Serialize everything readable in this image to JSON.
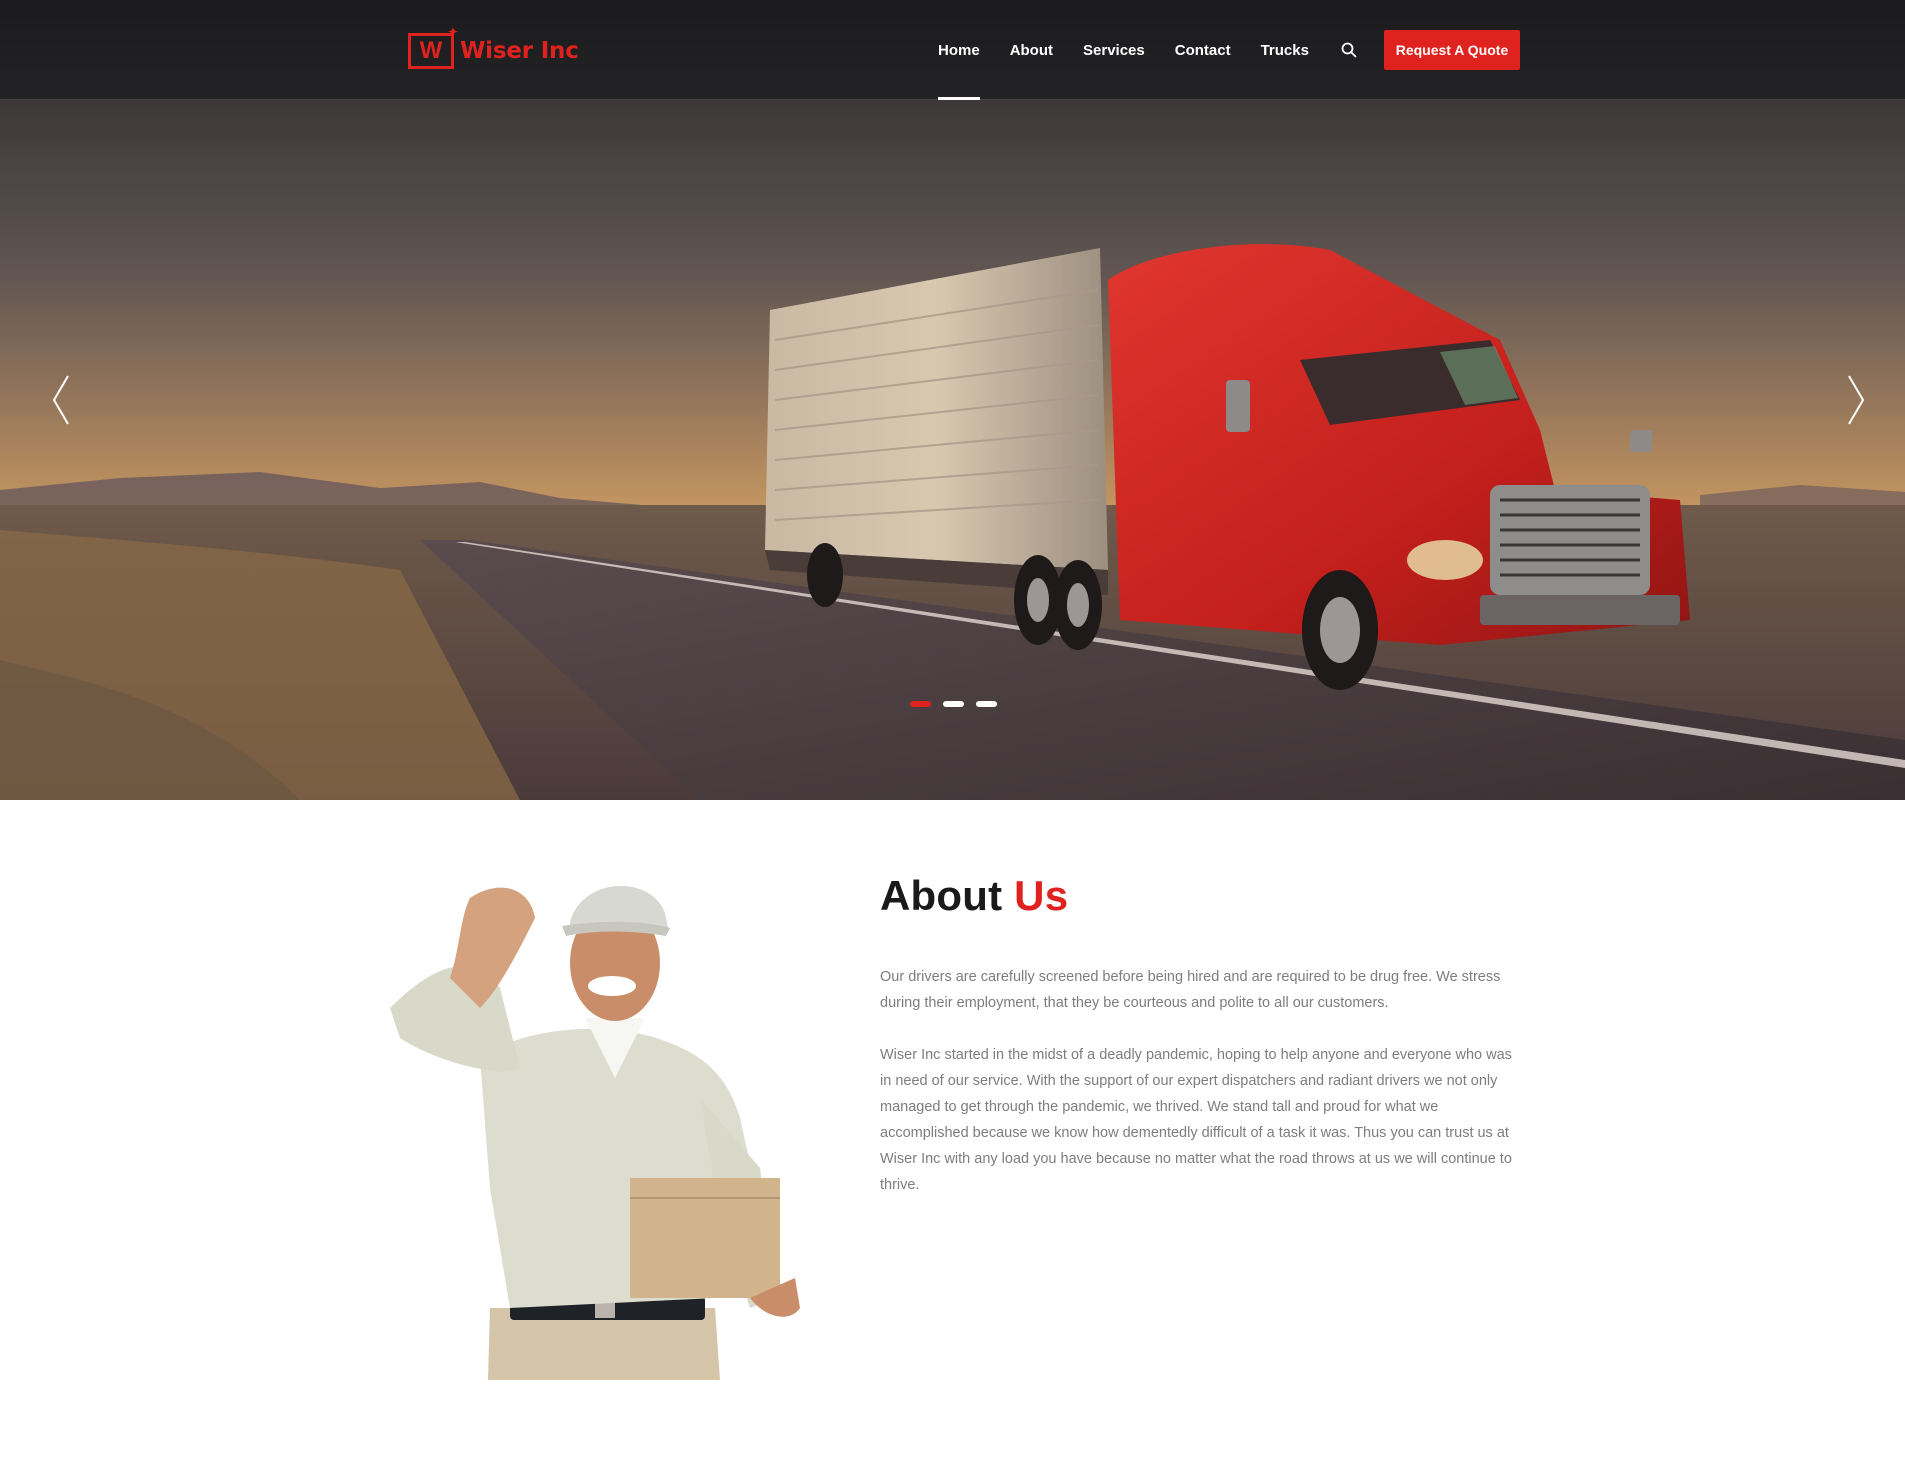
{
  "header": {
    "logo_mark": "W",
    "logo_text": "Wiser Inc",
    "nav": [
      {
        "label": "Home",
        "active": true
      },
      {
        "label": "About"
      },
      {
        "label": "Services"
      },
      {
        "label": "Contact"
      },
      {
        "label": "Trucks"
      }
    ],
    "search_icon": "search-icon",
    "cta_label": "Request A Quote"
  },
  "hero": {
    "prev_icon": "chevron-left-icon",
    "next_icon": "chevron-right-icon",
    "slides_total": 3,
    "active_slide": 1
  },
  "about": {
    "title_main": "About",
    "title_accent": "Us",
    "paragraph_1": "Our drivers are carefully screened before being hired and are required to be drug free. We stress during their employment, that they be courteous and polite to all our customers.",
    "paragraph_2": "Wiser Inc started in the midst of a deadly pandemic, hoping to help anyone and everyone who was in need of our service. With the support of our expert dispatchers and radiant drivers we not only managed to get through the pandemic, we thrived. We stand tall and proud for what we accomplished because we know how dementedly difficult of a task it was. Thus you can trust us at Wiser Inc with any load you have because no matter what the road throws at us we will continue to thrive."
  },
  "colors": {
    "accent": "#e0221f",
    "header_bg": "#1b1b1d",
    "body_text": "#7d7d7d",
    "heading": "#1a1a1a"
  }
}
